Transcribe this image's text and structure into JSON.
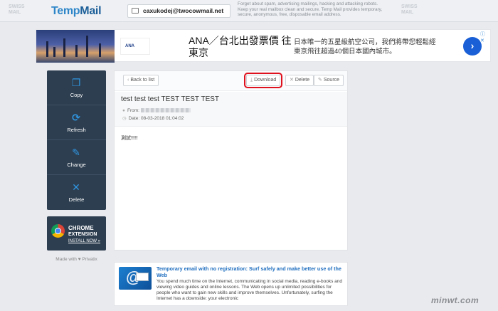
{
  "header": {
    "logo_a": "Temp",
    "logo_b": "Mail",
    "email": "caxukodej@twocowmail.net",
    "description": "Forget about spam, advertising mailings, hacking and attacking robots. Keep your real mailbox clean and secure. Temp Mail provides temporary, secure, anonymous, free, disposable email address.",
    "deco_left": "SWISS\nMAIL",
    "deco_right": "SWISS\nMAIL"
  },
  "ad": {
    "brand": "ANA",
    "title": "ANA／台北出發票價 往東京",
    "subtitle": "日本唯一的五星級航空公司，我們將帶您輕鬆經東京飛往超過40個日本國內城市。",
    "go_icon": "chevron-right-icon",
    "adchoices": "ⓘ ✕"
  },
  "sidebar": {
    "items": [
      {
        "label": "Copy",
        "icon": "clipboard-icon",
        "glyph": "❐"
      },
      {
        "label": "Refresh",
        "icon": "refresh-icon",
        "glyph": "⟳"
      },
      {
        "label": "Change",
        "icon": "pen-icon",
        "glyph": "✎"
      },
      {
        "label": "Delete",
        "icon": "close-icon",
        "glyph": "✕"
      }
    ],
    "chrome": {
      "line1": "CHROME",
      "line2": "EXTENSION",
      "line3": "INSTALL NOW »"
    },
    "made_by": "Made with ♥ Privatix"
  },
  "toolbar": {
    "back": "Back to list",
    "download": "Download",
    "delete": "Delete",
    "source": "Source"
  },
  "message": {
    "subject": "test test test TEST TEST TEST",
    "from_label": "From:",
    "date_label": "Date:",
    "date": "08-03-2018 01:04:02",
    "body": "測試!!!!!"
  },
  "article": {
    "title": "Temporary email with no registration: Surf safely and make better use of the Web",
    "text": "You spend much time on the Internet, communicating in social media, reading e-books and viewing video guides and online lessons. The Web opens up unlimited possibilities for people who want to gain new skills and improve themselves. Unfortunately, surfing the Internet has a downside: your electronic"
  },
  "watermark": "minwt.com",
  "colors": {
    "accent": "#2f95e0",
    "sidebar_bg": "#2d3e50",
    "highlight": "#e0111e",
    "link": "#1d6dbf"
  }
}
